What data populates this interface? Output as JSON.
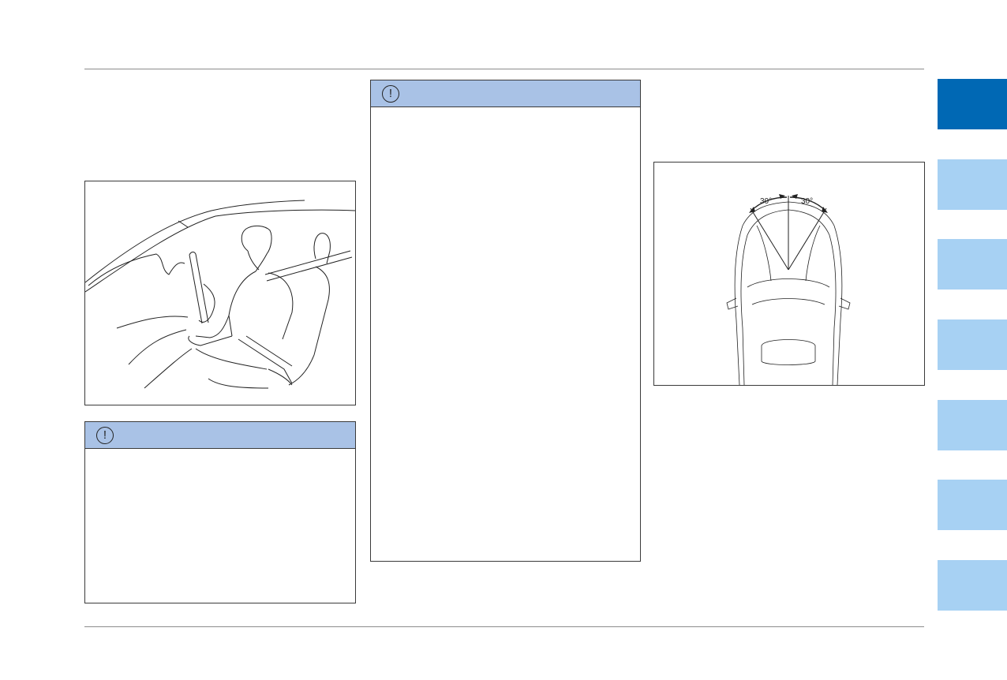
{
  "figures": {
    "headrest_angle": {
      "left_angle": "30°",
      "right_angle": "30°"
    }
  },
  "cautions": [
    {
      "icon": "caution-icon",
      "title": "",
      "body": ""
    },
    {
      "icon": "caution-icon",
      "title": "",
      "body": ""
    }
  ],
  "side_tabs": [
    {
      "label": "",
      "active": true
    },
    {
      "label": "",
      "active": false
    },
    {
      "label": "",
      "active": false
    },
    {
      "label": "",
      "active": false
    },
    {
      "label": "",
      "active": false
    },
    {
      "label": "",
      "active": false
    },
    {
      "label": "",
      "active": false
    }
  ],
  "colors": {
    "caution_header": "#a9c2e6",
    "tab_active": "#0068b4",
    "tab_inactive": "#a7d1f3"
  }
}
